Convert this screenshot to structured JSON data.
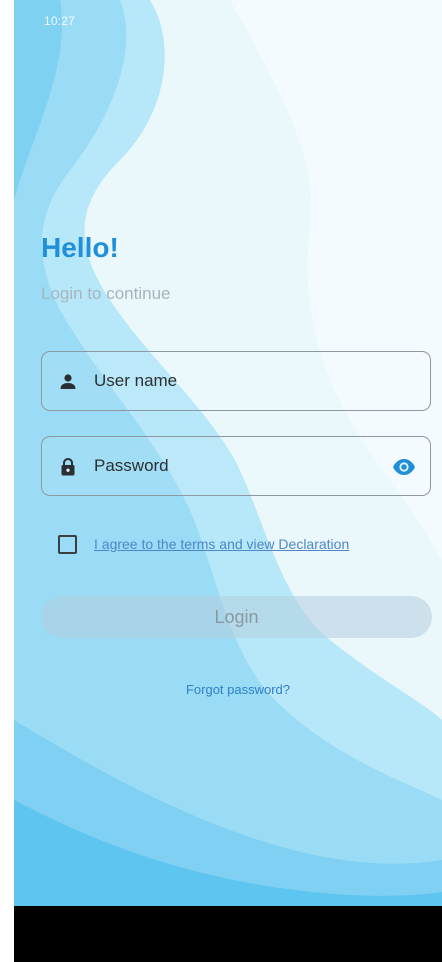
{
  "status_bar": {
    "time": "10:27"
  },
  "login": {
    "title": "Hello!",
    "subtitle": "Login to continue",
    "username_placeholder": "User name",
    "password_placeholder": "Password",
    "terms_text": "I agree to the terms and view Declaration",
    "login_label": "Login",
    "forgot_label": "Forgot password?"
  },
  "icons": {
    "username": "person-icon",
    "password": "lock-icon",
    "visibility": "eye-icon"
  },
  "colors": {
    "accent": "#1f8fd8",
    "link": "#4f86c9",
    "background_light": "#e6f7fc",
    "background_mid": "#a8e2f7",
    "background_deep": "#5ec7f1"
  }
}
